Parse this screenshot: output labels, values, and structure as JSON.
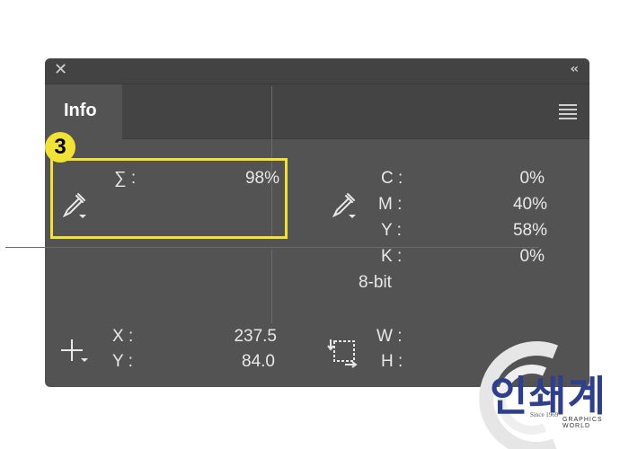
{
  "panel": {
    "tab_label": "Info",
    "icons": {
      "close": "close-icon",
      "collapse": "collapse-icon",
      "menu": "panel-menu-icon"
    }
  },
  "annotation": {
    "step_number": "3",
    "highlight_color": "#f2e233"
  },
  "readouts": {
    "total_ink": {
      "label": "∑ :",
      "value": "98%"
    },
    "cmyk": {
      "c": {
        "label": "C :",
        "value": "0%"
      },
      "m": {
        "label": "M :",
        "value": "40%"
      },
      "y": {
        "label": "Y :",
        "value": "58%"
      },
      "k": {
        "label": "K :",
        "value": "0%"
      },
      "bit_depth": "8-bit"
    },
    "position": {
      "x": {
        "label": "X :",
        "value": "237.5"
      },
      "y": {
        "label": "Y :",
        "value": "84.0"
      }
    },
    "size": {
      "w": {
        "label": "W :",
        "value": ""
      },
      "h": {
        "label": "H :",
        "value": ""
      }
    }
  },
  "watermark": {
    "text": "인쇄계",
    "since": "Since 1969",
    "brand": "GRAPHICS WORLD",
    "color": "#2f3f8f"
  }
}
